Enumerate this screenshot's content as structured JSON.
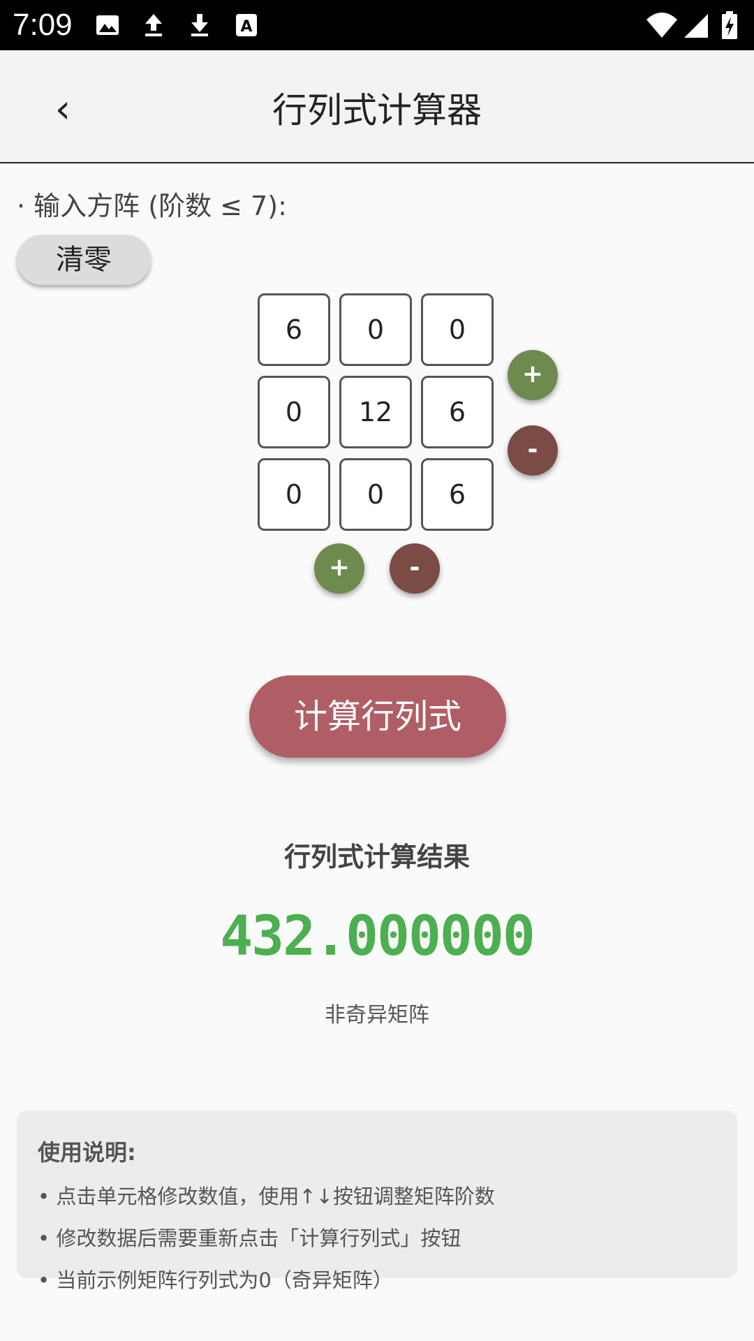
{
  "status_bar": {
    "time": "7:09",
    "left_icons": [
      "image-icon",
      "upload-icon",
      "download-icon",
      "font-icon"
    ],
    "right_icons": [
      "wifi-icon",
      "signal-icon",
      "battery-charging-icon"
    ]
  },
  "app_bar": {
    "back_icon": "chevron-left-icon",
    "back_glyph": "‹",
    "title": "行列式计算器"
  },
  "input_section": {
    "label": "· 输入方阵 (阶数 ≤ 7):",
    "clear_label": "清零"
  },
  "matrix": {
    "rows": [
      [
        "6",
        "0",
        "0"
      ],
      [
        "0",
        "12",
        "6"
      ],
      [
        "0",
        "0",
        "6"
      ]
    ]
  },
  "controls": {
    "add_label": "+",
    "remove_label": "-",
    "add_color": "#6e8a4f",
    "remove_color": "#7b4b45"
  },
  "calculate_label": "计算行列式",
  "result": {
    "title": "行列式计算结果",
    "value": "432.000000",
    "note": "非奇异矩阵",
    "value_color": "#4caf50"
  },
  "help": {
    "title": "使用说明:",
    "lines": [
      "• 点击单元格修改数值，使用↑↓按钮调整矩阵阶数",
      "• 修改数据后需要重新点击「计算行列式」按钮",
      "• 当前示例矩阵行列式为0（奇异矩阵）"
    ]
  }
}
